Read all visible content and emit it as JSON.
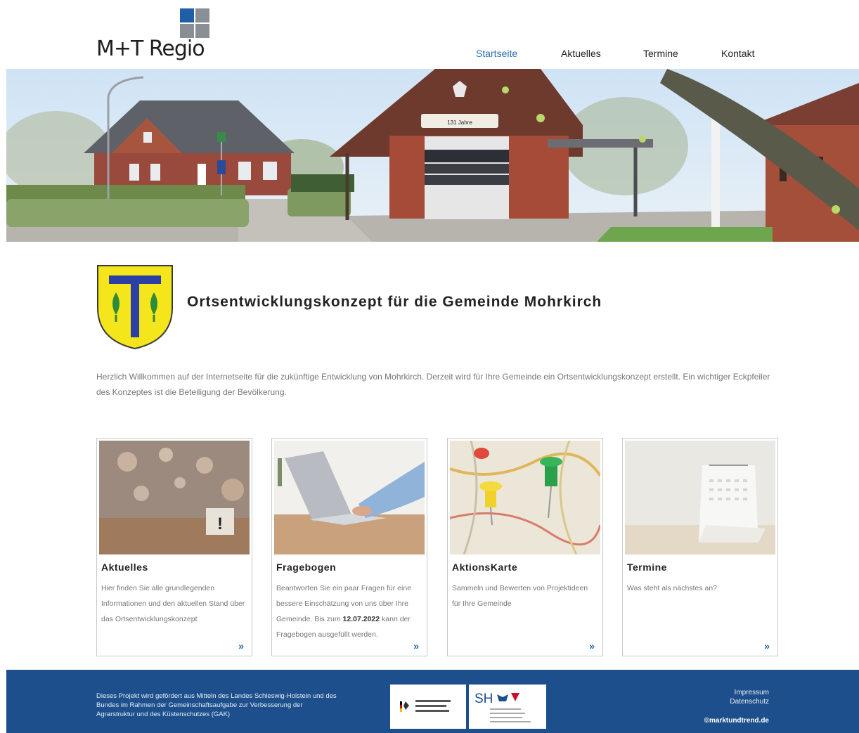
{
  "header": {
    "logo_text": "M+T Regio",
    "logo_colors": [
      "#1f5fa8",
      "#8a8f96",
      "#8a8f96",
      "#8a8f96"
    ]
  },
  "nav": {
    "items": [
      {
        "label": "Startseite",
        "active": true
      },
      {
        "label": "Aktuelles",
        "active": false
      },
      {
        "label": "Termine",
        "active": false
      },
      {
        "label": "Kontakt",
        "active": false
      }
    ]
  },
  "hero": {
    "banner_text": "131 Jahre"
  },
  "main": {
    "title": "Ortsentwicklungskonzept für die Gemeinde Mohrkirch",
    "intro": "Herzlich Willkommen auf der Internetseite für die zukünftige Entwicklung von Mohrkirch. Derzeit wird für Ihre Gemeinde ein Ortsentwicklungskonzept erstellt. Ein wichtiger Eckpfeiler des Konzeptes ist die Beteiligung der Bevölkerung."
  },
  "cards": [
    {
      "title": "Aktuelles",
      "text": "Hier finden Sie alle grundlegenden Informationen und den aktuellen Stand über das Ortsentwicklungskonzept",
      "arrow": "»"
    },
    {
      "title": "Fragebogen",
      "text_before": "Beantworten Sie ein paar Fragen für eine bessere Einschätzung von uns über Ihre Gemeinde. Bis zum ",
      "text_bold": "12.07.2022",
      "text_after": " kann der Fragebogen ausgefüllt werden.",
      "arrow": "»"
    },
    {
      "title": "AktionsKarte",
      "text": "Sammeln und Bewerten von Projektideen für Ihre Gemeinde",
      "arrow": "»"
    },
    {
      "title": "Termine",
      "text": "Was steht als nächstes an?",
      "arrow": "»"
    }
  ],
  "footer": {
    "funding_text": "Dieses Projekt wird gefördert aus Mitteln des Landes Schleswig-Holstein und des Bundes im Rahmen der Gemeinschaftsaufgabe zur Verbesserung der Agrarstruktur und des Küstenschutzes (GAK)",
    "sponsor_sh_label": "SH",
    "links": [
      "Impressum",
      "Datenschutz"
    ],
    "copyright": "©marktundtrend.de",
    "background_color": "#1c4f8c"
  }
}
